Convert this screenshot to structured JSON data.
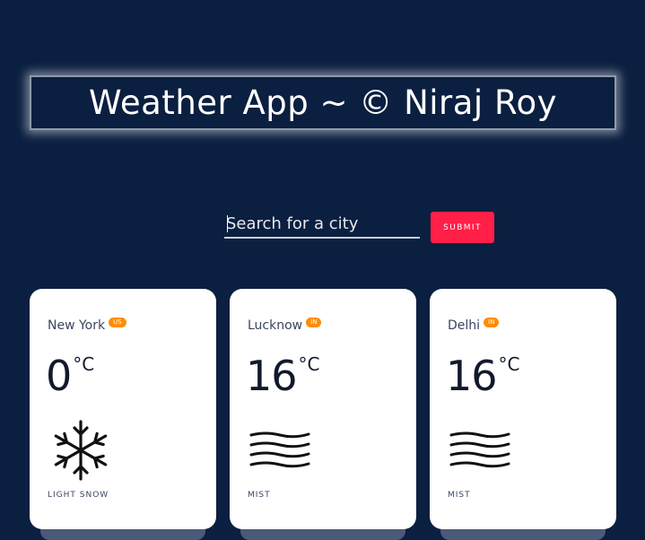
{
  "header": {
    "title": "Weather App ~ © Niraj Roy"
  },
  "search": {
    "placeholder": "Search for a city",
    "value": "",
    "submit_label": "SUBMIT"
  },
  "colors": {
    "background": "#0b1f40",
    "submit": "#ff1f47",
    "badge": "#ff8c00",
    "card": "#ffffff"
  },
  "cards": [
    {
      "city": "New York",
      "country": "US",
      "temperature": "0",
      "unit": "°C",
      "condition": "LIGHT SNOW",
      "icon": "snowflake-icon"
    },
    {
      "city": "Lucknow",
      "country": "IN",
      "temperature": "16",
      "unit": "°C",
      "condition": "MIST",
      "icon": "mist-icon"
    },
    {
      "city": "Delhi",
      "country": "IN",
      "temperature": "16",
      "unit": "°C",
      "condition": "MIST",
      "icon": "mist-icon"
    }
  ]
}
